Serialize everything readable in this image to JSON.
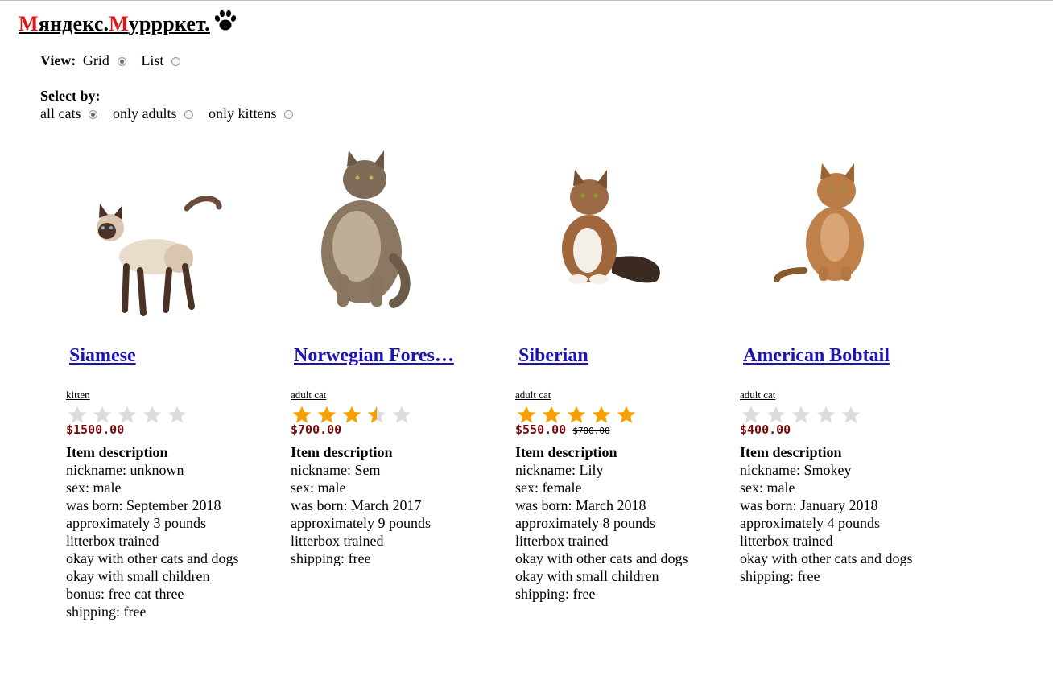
{
  "site": {
    "logo_parts": [
      "М",
      "яндекс.",
      "М",
      "урррк",
      "ет."
    ],
    "logo_icon": "paw-icon"
  },
  "view": {
    "label": "View:",
    "options": [
      {
        "label": "Grid",
        "selected": true
      },
      {
        "label": "List",
        "selected": false
      }
    ]
  },
  "select_by": {
    "label": "Select by:",
    "options": [
      {
        "label": "all cats",
        "selected": true
      },
      {
        "label": "only adults",
        "selected": false
      },
      {
        "label": "only kittens",
        "selected": false
      }
    ]
  },
  "description_heading": "Item description",
  "cats": [
    {
      "name": "Siamese",
      "age": "kitten",
      "rating": 0,
      "price": "$1500.00",
      "old_price": "",
      "details": [
        "nickname: unknown",
        "sex: male",
        "was born: September 2018",
        "approximately 3 pounds",
        "litterbox trained",
        "okay with other cats and dogs",
        "okay with small children",
        "bonus: free cat three",
        "shipping: free"
      ]
    },
    {
      "name": "Norwegian Fores…",
      "age": "adult cat",
      "rating": 3.5,
      "price": "$700.00",
      "old_price": "",
      "details": [
        "nickname: Sem",
        "sex: male",
        "was born: March 2017",
        "approximately 9 pounds",
        "litterbox trained",
        "shipping: free"
      ]
    },
    {
      "name": "Siberian",
      "age": "adult cat",
      "rating": 5,
      "price": "$550.00",
      "old_price": "$700.00",
      "details": [
        "nickname: Lily",
        "sex: female",
        "was born: March 2018",
        "approximately 8 pounds",
        "litterbox trained",
        "okay with other cats and dogs",
        "okay with small children",
        "shipping: free"
      ]
    },
    {
      "name": "American Bobtail",
      "age": "adult cat",
      "rating": 0,
      "price": "$400.00",
      "old_price": "",
      "details": [
        "nickname: Smokey",
        "sex: male",
        "was born: January 2018",
        "approximately 4 pounds",
        "litterbox trained",
        "okay with other cats and dogs",
        "shipping: free"
      ]
    }
  ],
  "colors": {
    "logo_accent": "#e0141b",
    "link": "#1e14b4",
    "price": "#7a0b0b",
    "star_on": "#f5a000",
    "star_off": "#dcdcdc"
  }
}
